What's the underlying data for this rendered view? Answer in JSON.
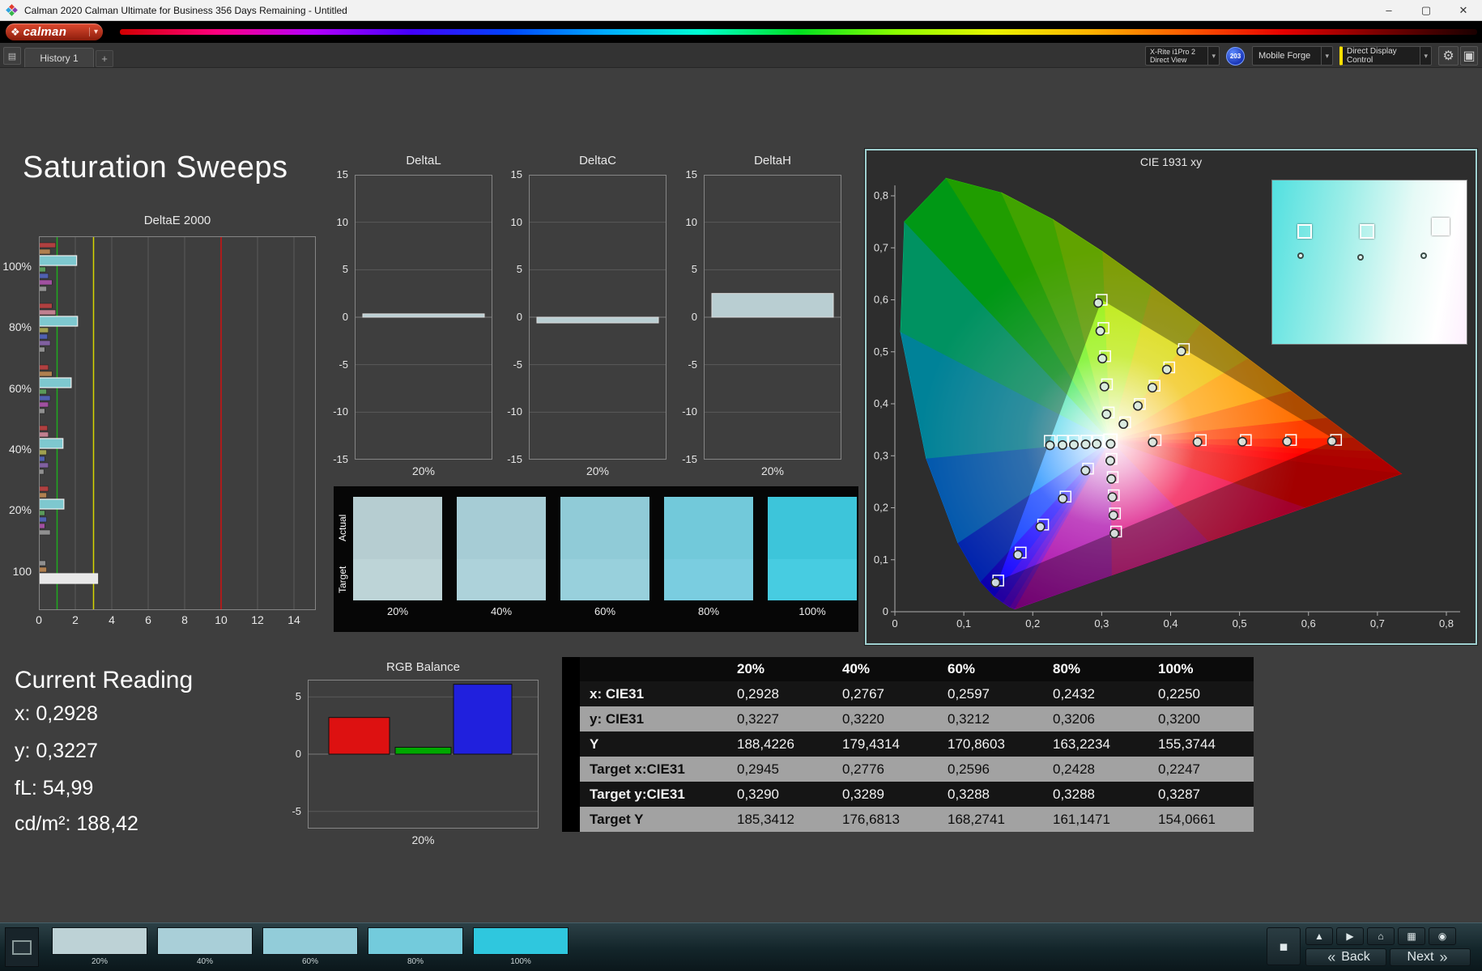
{
  "window": {
    "title": "Calman 2020 Calman Ultimate for Business 356 Days Remaining - Untitled",
    "controls": {
      "minimize": "–",
      "maximize": "▢",
      "close": "✕"
    }
  },
  "brand": {
    "name": "calman",
    "diamond": "❖",
    "caret": "▾"
  },
  "tabbar": {
    "panel_icon": "▤",
    "tab": "History 1",
    "add": "+"
  },
  "toolbar": {
    "meter_line1": "X-Rite i1Pro 2",
    "meter_line2": "Direct View",
    "badge": "203",
    "source": "Mobile Forge",
    "display_control": "Direct Display Control",
    "caret": "▾",
    "gear_icon": "⚙",
    "layout_icon": "▣"
  },
  "page": {
    "title": "Saturation Sweeps"
  },
  "current_reading": {
    "title": "Current Reading",
    "lines": [
      "x: 0,2928",
      "y: 0,3227",
      "fL: 54,99",
      "cd/m²: 188,42"
    ]
  },
  "chart_data": {
    "deltaE": {
      "type": "bar",
      "orientation": "horizontal",
      "title": "DeltaE 2000",
      "xlim": [
        0,
        15.2
      ],
      "x_ticks": [
        0,
        2,
        4,
        6,
        8,
        10,
        12,
        14
      ],
      "group_labels": [
        "100%",
        "80%",
        "60%",
        "40%",
        "20%",
        "100"
      ],
      "ref_lines": [
        {
          "value": 1,
          "color": "#1faa1f"
        },
        {
          "value": 3,
          "color": "#d6d600"
        },
        {
          "value": 10,
          "color": "#d01010"
        }
      ],
      "groups": [
        {
          "label": "100%",
          "bars": [
            {
              "color": "#b04040",
              "value": 0.9
            },
            {
              "color": "#b08050",
              "value": 0.6
            },
            {
              "color": "#7ec8cf",
              "value": 2.05,
              "highlight": true
            },
            {
              "color": "#5a9a5a",
              "value": 0.35
            },
            {
              "color": "#5060b0",
              "value": 0.5
            },
            {
              "color": "#a050a0",
              "value": 0.7
            },
            {
              "color": "#909090",
              "value": 0.4
            }
          ]
        },
        {
          "label": "80%",
          "bars": [
            {
              "color": "#b04040",
              "value": 0.7
            },
            {
              "color": "#c08090",
              "value": 0.9
            },
            {
              "color": "#7ec8cf",
              "value": 2.1,
              "highlight": true
            },
            {
              "color": "#a0a050",
              "value": 0.5
            },
            {
              "color": "#5060b0",
              "value": 0.45
            },
            {
              "color": "#8060a0",
              "value": 0.6
            },
            {
              "color": "#909090",
              "value": 0.3
            }
          ]
        },
        {
          "label": "60%",
          "bars": [
            {
              "color": "#b04040",
              "value": 0.5
            },
            {
              "color": "#b08050",
              "value": 0.7
            },
            {
              "color": "#7ec8cf",
              "value": 1.75,
              "highlight": true
            },
            {
              "color": "#5a9a5a",
              "value": 0.4
            },
            {
              "color": "#5060b0",
              "value": 0.6
            },
            {
              "color": "#a050a0",
              "value": 0.5
            },
            {
              "color": "#909090",
              "value": 0.3
            }
          ]
        },
        {
          "label": "40%",
          "bars": [
            {
              "color": "#b04040",
              "value": 0.45
            },
            {
              "color": "#c08090",
              "value": 0.5
            },
            {
              "color": "#7ec8cf",
              "value": 1.3,
              "highlight": true
            },
            {
              "color": "#a0a050",
              "value": 0.4
            },
            {
              "color": "#5060b0",
              "value": 0.3
            },
            {
              "color": "#8060a0",
              "value": 0.5
            },
            {
              "color": "#909090",
              "value": 0.25
            }
          ]
        },
        {
          "label": "20%",
          "bars": [
            {
              "color": "#b04040",
              "value": 0.5
            },
            {
              "color": "#b08050",
              "value": 0.4
            },
            {
              "color": "#7ec8cf",
              "value": 1.35,
              "highlight": true
            },
            {
              "color": "#5a9a5a",
              "value": 0.3
            },
            {
              "color": "#5060b0",
              "value": 0.4
            },
            {
              "color": "#a050a0",
              "value": 0.3
            },
            {
              "color": "#909090",
              "value": 0.6
            }
          ]
        },
        {
          "label": "100",
          "bars": [
            {
              "color": "#909090",
              "value": 0.35
            },
            {
              "color": "#b08050",
              "value": 0.4
            },
            {
              "color": "#e8e8e8",
              "value": 3.2,
              "highlight": true
            }
          ]
        }
      ]
    },
    "deltaL": {
      "type": "bar",
      "title": "DeltaL",
      "ylim": [
        -15,
        15
      ],
      "y_ticks": [
        15,
        10,
        5,
        0,
        -5,
        -10,
        -15
      ],
      "category": "20%",
      "value": 0.35,
      "bar_color": "#b9ced2"
    },
    "deltaC": {
      "type": "bar",
      "title": "DeltaC",
      "ylim": [
        -15,
        15
      ],
      "y_ticks": [
        15,
        10,
        5,
        0,
        -5,
        -10,
        -15
      ],
      "category": "20%",
      "value": -0.6,
      "bar_color": "#b9ced2"
    },
    "deltaH": {
      "type": "bar",
      "title": "DeltaH",
      "ylim": [
        -15,
        15
      ],
      "y_ticks": [
        15,
        10,
        5,
        0,
        -5,
        -10,
        -15
      ],
      "category": "20%",
      "value": 2.5,
      "bar_color": "#b9ced2"
    },
    "rgb_balance": {
      "type": "bar",
      "title": "RGB Balance",
      "ylim": [
        -6.5,
        6.5
      ],
      "y_ticks": [
        5,
        0,
        -5
      ],
      "category": "20%",
      "series": [
        {
          "name": "Red",
          "value": 3.2,
          "color": "#dd1111"
        },
        {
          "name": "Green",
          "value": 0.6,
          "color": "#00a800"
        },
        {
          "name": "Blue",
          "value": 6.1,
          "color": "#2020dd"
        }
      ]
    },
    "swatch_compare": {
      "rows": [
        "Actual",
        "Target"
      ],
      "columns": [
        "20%",
        "40%",
        "60%",
        "80%",
        "100%"
      ],
      "actual": [
        "#b6cdd1",
        "#a6ccd5",
        "#90cbd7",
        "#72c9da",
        "#3dc5da"
      ],
      "target": [
        "#bdd4d7",
        "#add2da",
        "#98d0dc",
        "#7acde0",
        "#47cce1"
      ]
    },
    "cie": {
      "type": "scatter",
      "title": "CIE 1931 xy",
      "xlim": [
        0,
        0.8
      ],
      "ylim": [
        0,
        0.8
      ],
      "x_tick_labels": [
        "0",
        "0,1",
        "0,2",
        "0,3",
        "0,4",
        "0,5",
        "0,6",
        "0,7",
        "0,8"
      ],
      "y_tick_labels": [
        "0",
        "0,1",
        "0,2",
        "0,3",
        "0,4",
        "0,5",
        "0,6",
        "0,7",
        "0,8"
      ],
      "gamut_triangle": [
        [
          0.64,
          0.33
        ],
        [
          0.3,
          0.6
        ],
        [
          0.15,
          0.06
        ]
      ],
      "white_point_target": [
        0.3127,
        0.329
      ],
      "white_point_measured": [
        0.313,
        0.323
      ],
      "sweeps": [
        {
          "name": "cyan",
          "targets": [
            [
              0.2945,
              0.329
            ],
            [
              0.2776,
              0.3289
            ],
            [
              0.2596,
              0.3288
            ],
            [
              0.2428,
              0.3288
            ],
            [
              0.2247,
              0.3287
            ]
          ],
          "measured": [
            [
              0.2928,
              0.3227
            ],
            [
              0.2767,
              0.322
            ],
            [
              0.2597,
              0.3212
            ],
            [
              0.2432,
              0.3206
            ],
            [
              0.225,
              0.32
            ]
          ]
        },
        {
          "name": "red",
          "targets": [
            [
              0.3782,
              0.3301
            ],
            [
              0.4437,
              0.3302
            ],
            [
              0.5091,
              0.3303
            ],
            [
              0.5746,
              0.3304
            ],
            [
              0.64,
              0.3305
            ]
          ],
          "measured": [
            [
              0.374,
              0.326
            ],
            [
              0.439,
              0.3265
            ],
            [
              0.504,
              0.327
            ],
            [
              0.569,
              0.3275
            ],
            [
              0.634,
              0.328
            ]
          ]
        },
        {
          "name": "green",
          "targets": [
            [
              0.3102,
              0.3832
            ],
            [
              0.3077,
              0.4374
            ],
            [
              0.3051,
              0.4916
            ],
            [
              0.3026,
              0.5458
            ],
            [
              0.3,
              0.6
            ]
          ],
          "measured": [
            [
              0.307,
              0.38
            ],
            [
              0.304,
              0.433
            ],
            [
              0.301,
              0.487
            ],
            [
              0.298,
              0.54
            ],
            [
              0.295,
              0.594
            ]
          ]
        },
        {
          "name": "blue",
          "targets": [
            [
              0.2802,
              0.2752
            ],
            [
              0.2476,
              0.2214
            ],
            [
              0.2151,
              0.1676
            ],
            [
              0.1825,
              0.1138
            ],
            [
              0.15,
              0.06
            ]
          ],
          "measured": [
            [
              0.2765,
              0.2715
            ],
            [
              0.2435,
              0.2175
            ],
            [
              0.211,
              0.1635
            ],
            [
              0.1785,
              0.1095
            ],
            [
              0.146,
              0.056
            ]
          ]
        },
        {
          "name": "yellow",
          "targets": [
            [
              0.334,
              0.3643
            ],
            [
              0.3553,
              0.3995
            ],
            [
              0.3767,
              0.4348
            ],
            [
              0.398,
              0.47
            ],
            [
              0.4193,
              0.5053
            ]
          ],
          "measured": [
            [
              0.3315,
              0.361
            ],
            [
              0.3525,
              0.396
            ],
            [
              0.3735,
              0.431
            ],
            [
              0.3945,
              0.466
            ],
            [
              0.4155,
              0.501
            ]
          ]
        },
        {
          "name": "magenta",
          "targets": [
            [
              0.3143,
              0.294
            ],
            [
              0.316,
              0.259
            ],
            [
              0.3176,
              0.2241
            ],
            [
              0.3193,
              0.1891
            ],
            [
              0.3209,
              0.1542
            ]
          ],
          "measured": [
            [
              0.3125,
              0.2905
            ],
            [
              0.314,
              0.2555
            ],
            [
              0.3155,
              0.2205
            ],
            [
              0.317,
              0.1855
            ],
            [
              0.3185,
              0.1505
            ]
          ]
        }
      ],
      "inset": {
        "squares": [
          [
            0.16,
            0.3
          ],
          [
            0.48,
            0.3
          ],
          [
            0.86,
            0.27
          ]
        ],
        "circles": [
          [
            0.145,
            0.46
          ],
          [
            0.455,
            0.47
          ],
          [
            0.78,
            0.46
          ]
        ]
      }
    }
  },
  "table": {
    "columns": [
      "20%",
      "40%",
      "60%",
      "80%",
      "100%"
    ],
    "rows": [
      {
        "label": "x: CIE31",
        "values": [
          "0,2928",
          "0,2767",
          "0,2597",
          "0,2432",
          "0,2250"
        ]
      },
      {
        "label": "y: CIE31",
        "values": [
          "0,3227",
          "0,3220",
          "0,3212",
          "0,3206",
          "0,3200"
        ]
      },
      {
        "label": "Y",
        "values": [
          "188,4226",
          "179,4314",
          "170,8603",
          "163,2234",
          "155,3744"
        ]
      },
      {
        "label": "Target x:CIE31",
        "values": [
          "0,2945",
          "0,2776",
          "0,2596",
          "0,2428",
          "0,2247"
        ]
      },
      {
        "label": "Target y:CIE31",
        "values": [
          "0,3290",
          "0,3289",
          "0,3288",
          "0,3288",
          "0,3287"
        ]
      },
      {
        "label": "Target Y",
        "values": [
          "185,3412",
          "176,6813",
          "168,2741",
          "161,1471",
          "154,0661"
        ]
      }
    ]
  },
  "bottom": {
    "swatches": [
      {
        "label": "20%",
        "color": "#bdd2d6"
      },
      {
        "label": "40%",
        "color": "#a9cfd8"
      },
      {
        "label": "60%",
        "color": "#92ccd9"
      },
      {
        "label": "80%",
        "color": "#73cbdc"
      },
      {
        "label": "100%",
        "color": "#2fc7de"
      }
    ],
    "tool_buttons": [
      {
        "name": "eject-button",
        "glyph": "▲"
      },
      {
        "name": "play-button",
        "glyph": "▶"
      },
      {
        "name": "home-button",
        "glyph": "⌂"
      },
      {
        "name": "pattern-grid-button",
        "glyph": "▦"
      },
      {
        "name": "record-button",
        "glyph": "◉"
      }
    ],
    "stop_icon": "◼",
    "back_icon": "«",
    "back_label": "Back",
    "next_label": "Next",
    "next_icon": "»"
  }
}
